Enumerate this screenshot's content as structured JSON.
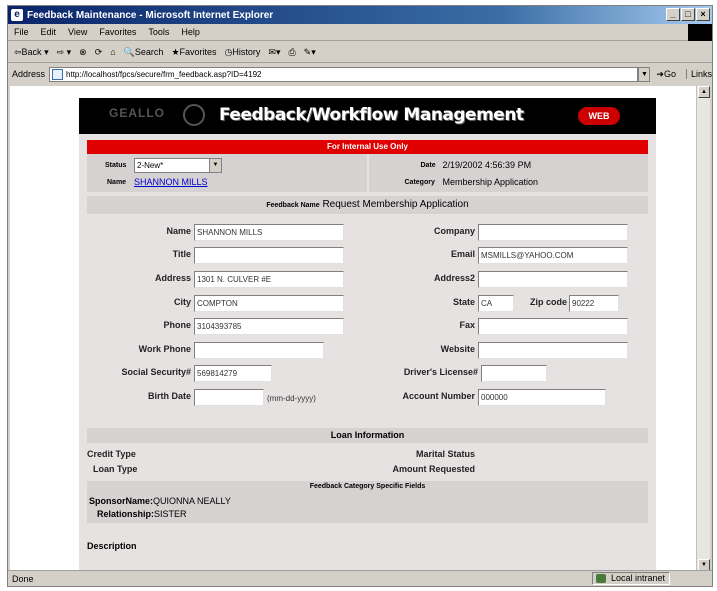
{
  "browser": {
    "title": "Feedback Maintenance - Microsoft Internet Explorer",
    "menu": [
      "File",
      "Edit",
      "View",
      "Favorites",
      "Tools",
      "Help"
    ],
    "toolbar": {
      "back": "Back",
      "search": "Search",
      "favorites": "Favorites",
      "history": "History"
    },
    "address_label": "Address",
    "address": "http://localhost/fpcs/secure/frm_feedback.asp?ID=4192",
    "go": "Go",
    "links": "Links",
    "status_left": "Done",
    "zone": "Local intranet"
  },
  "banner": {
    "title": "Feedback/Workflow Management",
    "brand": "WEB"
  },
  "internal": {
    "label": "For Internal Use Only"
  },
  "status": {
    "label": "Status",
    "value": "2-New*"
  },
  "date": {
    "label": "Date",
    "value": "2/19/2002 4:56:39 PM"
  },
  "name_link": {
    "label": "Name",
    "value": "SHANNON MILLS"
  },
  "category": {
    "label": "Category",
    "value": "Membership Application"
  },
  "feedback_name": {
    "label": "Feedback Name",
    "value": "Request Membership Application"
  },
  "fields": {
    "name": {
      "label": "Name",
      "value": "SHANNON MILLS"
    },
    "title": {
      "label": "Title",
      "value": ""
    },
    "address": {
      "label": "Address",
      "value": "1301 N. CULVER #E"
    },
    "city": {
      "label": "City",
      "value": "COMPTON"
    },
    "phone": {
      "label": "Phone",
      "value": "3104393785"
    },
    "work_phone": {
      "label": "Work Phone",
      "value": ""
    },
    "ssn": {
      "label": "Social Security#",
      "value": "569814279"
    },
    "birth_date": {
      "label": "Birth Date",
      "value": "",
      "hint": "(mm-dd-yyyy)"
    },
    "company": {
      "label": "Company",
      "value": ""
    },
    "email": {
      "label": "Email",
      "value": "MSMILLS@YAHOO.COM"
    },
    "address2": {
      "label": "Address2",
      "value": ""
    },
    "state": {
      "label": "State",
      "value": "CA"
    },
    "zip": {
      "label": "Zip code",
      "value": "90222"
    },
    "fax": {
      "label": "Fax",
      "value": ""
    },
    "website": {
      "label": "Website",
      "value": ""
    },
    "license": {
      "label": "Driver's License#",
      "value": ""
    },
    "account": {
      "label": "Account Number",
      "value": "000000"
    }
  },
  "loan": {
    "header": "Loan Information",
    "credit_type": "Credit Type",
    "loan_type": "Loan Type",
    "marital_status": "Marital Status",
    "amount_requested": "Amount Requested"
  },
  "category_fields": {
    "header": "Feedback Category Specific Fields",
    "sponsor_label": "SponsorName:",
    "sponsor_value": "QUIONNA NEALLY",
    "relationship_label": "Relationship:",
    "relationship_value": "SISTER"
  },
  "description_label": "Description"
}
